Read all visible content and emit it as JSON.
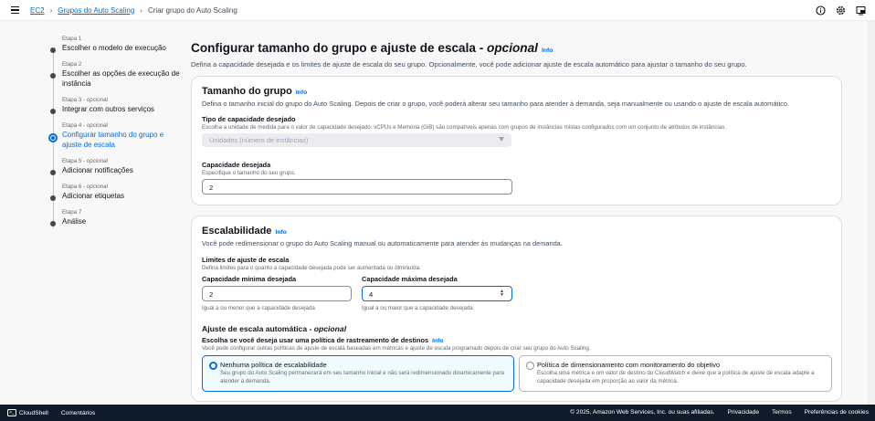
{
  "breadcrumb": {
    "service": "EC2",
    "parent": "Grupos do Auto Scaling",
    "current": "Criar grupo do Auto Scaling"
  },
  "steps": [
    {
      "label": "Etapa 1",
      "optional": "",
      "name": "Escolher o modelo de execução"
    },
    {
      "label": "Etapa 2",
      "optional": "",
      "name": "Escolher as opções de execução de instância"
    },
    {
      "label": "Etapa 3 - ",
      "optional": "opcional",
      "name": "Integrar com outros serviços"
    },
    {
      "label": "Etapa 4 - ",
      "optional": "opcional",
      "name": "Configurar tamanho do grupo e ajuste de escala"
    },
    {
      "label": "Etapa 5 - ",
      "optional": "opcional",
      "name": "Adicionar notificações"
    },
    {
      "label": "Etapa 6 - ",
      "optional": "opcional",
      "name": "Adicionar etiquetas"
    },
    {
      "label": "Etapa 7",
      "optional": "",
      "name": "Análise"
    }
  ],
  "page": {
    "title": "Configurar tamanho do grupo e ajuste de escala - ",
    "title_italic": "opcional",
    "info": "Info",
    "subtitle": "Defina a capacidade desejada e os limites de ajuste de escala do seu grupo. Opcionalmente, você pode adicionar ajuste de escala automático para ajustar o tamanho do seu grupo."
  },
  "group_size": {
    "title": "Tamanho do grupo",
    "info": "Info",
    "desc": "Defina o tamanho inicial do grupo do Auto Scaling. Depois de criar o grupo, você poderá alterar seu tamanho para atender à demanda, seja manualmente ou usando o ajuste de escala automático.",
    "capacity_type_label": "Tipo de capacidade desejado",
    "capacity_type_desc": "Escolha a unidade de medida para o valor de capacidade desejado. vCPUs e Memória (GiB) são compatíveis apenas com grupos de instâncias mistas configurados com um conjunto de atributos de instâncias.",
    "capacity_type_value": "Unidades (número de instâncias)",
    "desired_label": "Capacidade desejada",
    "desired_desc": "Especifique o tamanho do seu grupo.",
    "desired_value": "2"
  },
  "scalability": {
    "title": "Escalabilidade",
    "info": "Info",
    "desc": "Você pode redimensionar o grupo do Auto Scaling manual ou automaticamente para atender às mudanças na demanda.",
    "limits_label": "Limites de ajuste de escala",
    "limits_desc": "Defina limites para o quanto a capacidade desejada pode ser aumentada ou diminuída.",
    "min_label": "Capacidade mínima desejada",
    "min_value": "2",
    "min_hint": "Igual a ou menor que a capacidade desejada",
    "max_label": "Capacidade máxima desejada",
    "max_value": "4",
    "max_hint": "Igual a ou maior que a capacidade desejada",
    "auto_title": "Ajuste de escala automática - ",
    "auto_title_italic": "opcional",
    "policy_label": "Escolha se você deseja usar uma política de rastreamento de destinos",
    "policy_info": "Info",
    "policy_desc": "Você pode configurar outras políticas de ajuste de escala baseadas em métricas e ajuste de escala programado depois de criar seu grupo do Auto Scaling.",
    "options": [
      {
        "title": "Nenhuma política de escalabilidade",
        "desc": "Seu grupo do Auto Scaling permanecerá em seu tamanho inicial e não será redimensionado dinamicamente para atender à demanda.",
        "selected": true
      },
      {
        "title": "Política de dimensionamento com monitoramento do objetivo",
        "desc": "Escolha uma métrica e um valor de destino do CloudWatch e deixe que a política de ajuste de escala adapte a capacidade desejada em proporção ao valor da métrica.",
        "selected": false
      }
    ]
  },
  "footer": {
    "cloudshell": "CloudShell",
    "feedback": "Comentários",
    "copyright": "© 2025, Amazon Web Services, Inc. ou suas afiliadas.",
    "privacy": "Privacidade",
    "terms": "Termos",
    "cookies": "Preferências de cookies"
  },
  "colors": {
    "accent": "#006ce0",
    "footer_bg": "#0f1b2a"
  }
}
